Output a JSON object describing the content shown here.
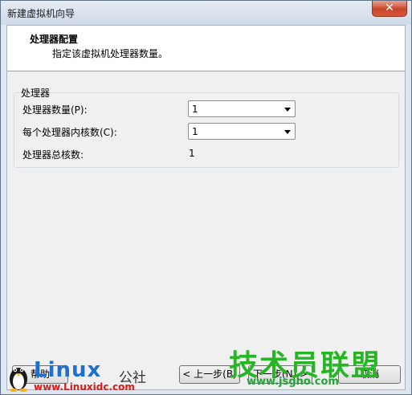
{
  "window": {
    "title": "新建虚拟机向导",
    "close_glyph": "✕"
  },
  "header": {
    "title": "处理器配置",
    "subtitle": "指定该虚拟机处理器数量。"
  },
  "group": {
    "title": "处理器",
    "processor_count_label": "处理器数量(P):",
    "processor_count_value": "1",
    "cores_per_processor_label": "每个处理器内核数(C):",
    "cores_per_processor_value": "1",
    "total_cores_label": "处理器总核数:",
    "total_cores_value": "1"
  },
  "buttons": {
    "help": "帮助",
    "back": "< 上一步(B)",
    "next": "下一步(N) >",
    "cancel": "取消"
  },
  "watermark": {
    "linux": "Linux",
    "gongshe": "公社",
    "linux_url": "www.Linuxidc.com",
    "cn_brand": "技术员联盟",
    "cn_url": "www.jsgho.com"
  },
  "colors": {
    "accent": "#1f6fd0",
    "brand_green": "#27b526",
    "close_red": "#c8452b"
  }
}
